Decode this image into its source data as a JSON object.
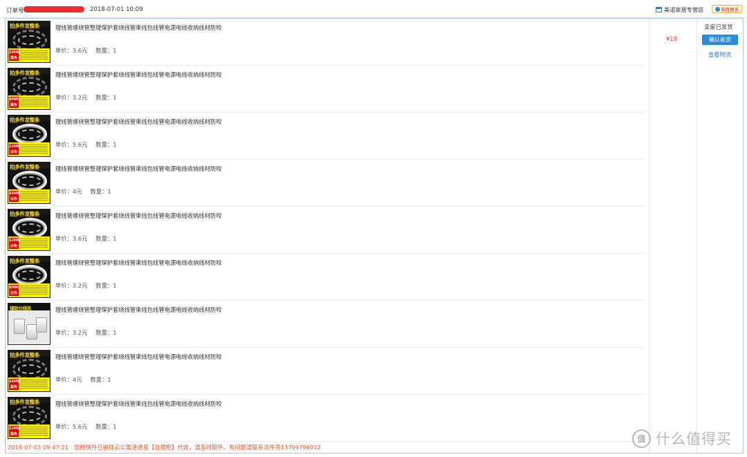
{
  "header": {
    "order_label": "订单号",
    "order_date": "2018-07-01 10:09",
    "shop_name": "美诺家居专营店",
    "contact_label": "和我联系"
  },
  "items": [
    {
      "title": "理线管缠绕管整理保护套绕线管束线包线管电源电线收纳线材防咬",
      "price_label": "单价：3.6元",
      "qty_label": "数量：1",
      "banner": "拍多件发整条",
      "tag": "20MM 黑色",
      "variant": "black"
    },
    {
      "title": "理线管缠绕管整理保护套绕线管束线包线管电源电线收纳线材防咬",
      "price_label": "单价：3.2元",
      "qty_label": "数量：1",
      "banner": "拍多件发整条",
      "tag": "8MM 黑色",
      "variant": "black"
    },
    {
      "title": "理线管缠绕管整理保护套绕线管束线包线管电源电线收纳线材防咬",
      "price_label": "单价：5.6元",
      "qty_label": "数量：1",
      "banner": "拍多件发整条",
      "tag": "22MM 白色",
      "variant": "white"
    },
    {
      "title": "理线管缠绕管整理保护套绕线管束线包线管电源电线收纳线材防咬",
      "price_label": "单价：4元",
      "qty_label": "数量：1",
      "banner": "拍多件发整条",
      "tag": "16MM 白色",
      "variant": "white"
    },
    {
      "title": "理线管缠绕管整理保护套绕线管束线包线管电源电线收纳线材防咬",
      "price_label": "单价：3.6元",
      "qty_label": "数量：1",
      "banner": "拍多件发整条",
      "tag": "12MM 白色",
      "variant": "white"
    },
    {
      "title": "理线管缠绕管整理保护套绕线管束线包线管电源电线收纳线材防咬",
      "price_label": "单价：3.2元",
      "qty_label": "数量：1",
      "banner": "拍多件发整条",
      "tag": "8MM 白色",
      "variant": "white"
    },
    {
      "title": "理线管缠绕管整理保护套绕线管束线包线管电源电线收纳线材防咬",
      "price_label": "单价：3.2元",
      "qty_label": "数量：1",
      "banner": "辅助分线夹",
      "tag": "",
      "variant": "clip"
    },
    {
      "title": "理线管缠绕管整理保护套绕线管束线包线管电源电线收纳线材防咬",
      "price_label": "单价：4元",
      "qty_label": "数量：1",
      "banner": "拍多件发整条",
      "tag": "16MM 黑色",
      "variant": "black"
    },
    {
      "title": "理线管缠绕管整理保护套绕线管束线包线管电源电线收纳线材防咬",
      "price_label": "单价：5.6元",
      "qty_label": "数量：1",
      "banner": "拍多件发整条",
      "tag": "22MM 黑色",
      "variant": "black"
    }
  ],
  "order": {
    "total_price": "¥18",
    "status": "卖家已发货",
    "confirm_label": "确认收货",
    "logistics_label": "查看物流"
  },
  "footer": {
    "time": "2018-07-03 09:47:21",
    "message": "您的快件已被祥云公寓速递易【自提柜】代收，请及时取件。有问题请联系派件员13799796012"
  },
  "watermark": {
    "badge": "值",
    "text": "什么值得买"
  },
  "colors": {
    "accent_blue": "#2d8ad9",
    "price_red": "#ee3b2b",
    "footer_orange": "#e4552d",
    "panel_border": "#a8c9e9"
  }
}
